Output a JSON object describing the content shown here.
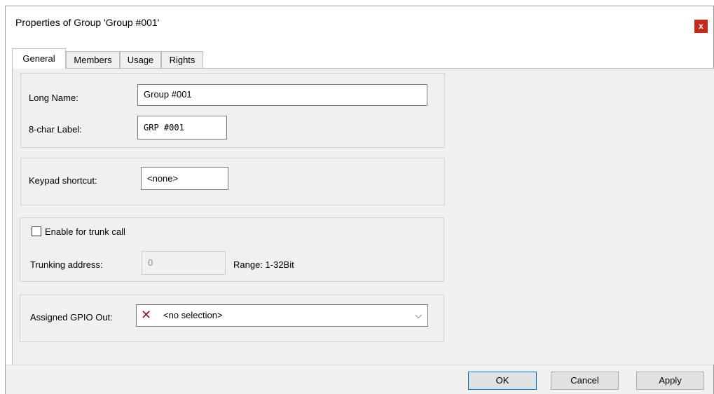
{
  "window": {
    "title": "Properties of Group 'Group #001'",
    "close_label": "x"
  },
  "tabs": [
    {
      "label": "General",
      "active": true
    },
    {
      "label": "Members",
      "active": false
    },
    {
      "label": "Usage",
      "active": false
    },
    {
      "label": "Rights",
      "active": false
    }
  ],
  "names": {
    "long_name_label": "Long Name:",
    "long_name_value": "Group #001",
    "label8_label": "8-char Label:",
    "label8_value": "GRP #001"
  },
  "keypad": {
    "label": "Keypad shortcut:",
    "value": "<none>"
  },
  "trunk": {
    "enable_label": "Enable for trunk call",
    "enabled": false,
    "address_label": "Trunking address:",
    "address_value": "0",
    "range_text": "Range: 1-32Bit"
  },
  "gpio": {
    "label": "Assigned GPIO Out:",
    "selected": "<no selection>",
    "icon": "red-x-icon"
  },
  "buttons": {
    "ok": "OK",
    "cancel": "Cancel",
    "apply": "Apply"
  }
}
